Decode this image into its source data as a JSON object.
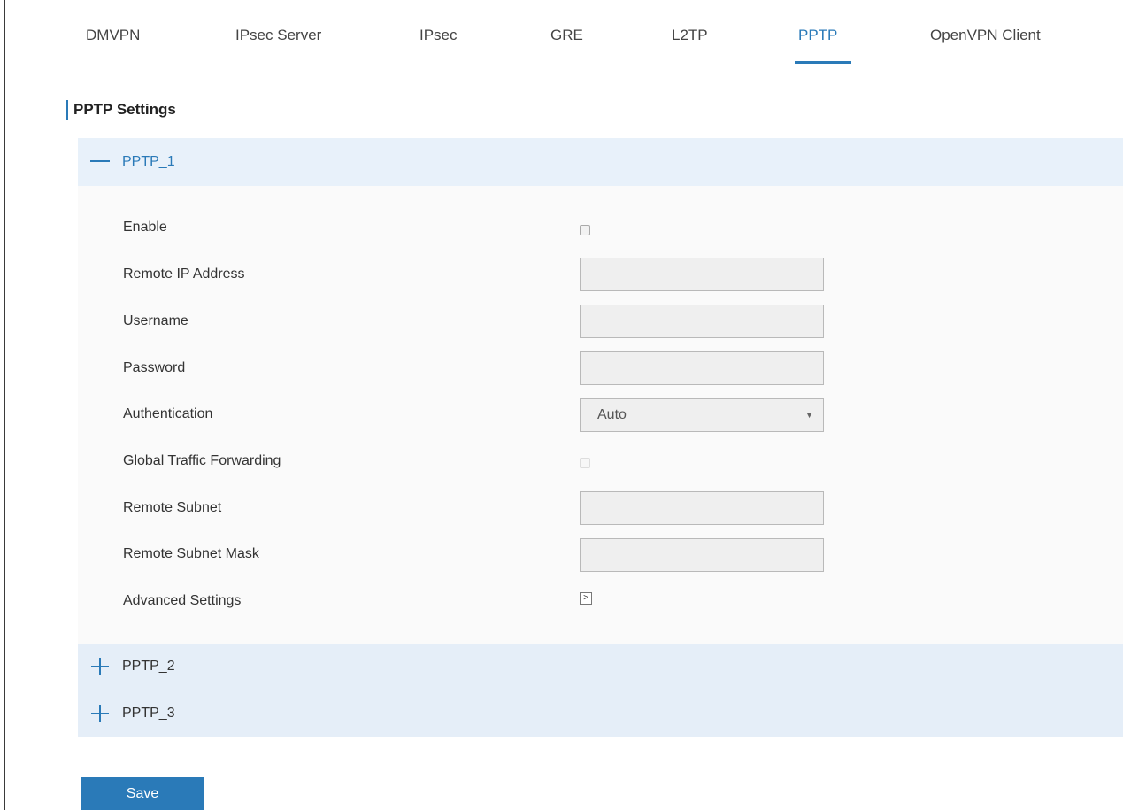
{
  "tabs": [
    {
      "label": "DMVPN",
      "active": false
    },
    {
      "label": "IPsec Server",
      "active": false
    },
    {
      "label": "IPsec",
      "active": false
    },
    {
      "label": "GRE",
      "active": false
    },
    {
      "label": "L2TP",
      "active": false
    },
    {
      "label": "PPTP",
      "active": true
    },
    {
      "label": "OpenVPN Client",
      "active": false
    }
  ],
  "section_title": "PPTP Settings",
  "accordions": [
    {
      "title": "PPTP_1",
      "expanded": true
    },
    {
      "title": "PPTP_2",
      "expanded": false
    },
    {
      "title": "PPTP_3",
      "expanded": false
    }
  ],
  "form": {
    "enable": {
      "label": "Enable",
      "checked": false
    },
    "remote_ip": {
      "label": "Remote IP Address",
      "value": ""
    },
    "username": {
      "label": "Username",
      "value": ""
    },
    "password": {
      "label": "Password",
      "value": ""
    },
    "authentication": {
      "label": "Authentication",
      "value": "Auto"
    },
    "global_traffic": {
      "label": "Global Traffic Forwarding",
      "checked": false
    },
    "remote_subnet": {
      "label": "Remote Subnet",
      "value": ""
    },
    "remote_subnet_mask": {
      "label": "Remote Subnet Mask",
      "value": ""
    },
    "advanced": {
      "label": "Advanced Settings",
      "icon": "expand-right-icon"
    }
  },
  "save_label": "Save",
  "colors": {
    "accent": "#2a7ab8",
    "accordion_bg": "#e8f1fa"
  }
}
